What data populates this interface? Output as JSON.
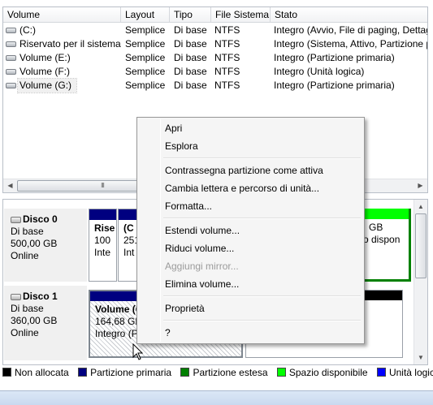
{
  "columns": [
    "Volume",
    "Layout",
    "Tipo",
    "File Sistema",
    "Stato"
  ],
  "volumes": [
    {
      "name": "(C:)",
      "layout": "Semplice",
      "type": "Di base",
      "fs": "NTFS",
      "status": "Integro (Avvio, File di paging, Dettag"
    },
    {
      "name": "Riservato per il sistema",
      "layout": "Semplice",
      "type": "Di base",
      "fs": "NTFS",
      "status": "Integro (Sistema, Attivo, Partizione p"
    },
    {
      "name": "Volume (E:)",
      "layout": "Semplice",
      "type": "Di base",
      "fs": "NTFS",
      "status": "Integro (Partizione primaria)"
    },
    {
      "name": "Volume (F:)",
      "layout": "Semplice",
      "type": "Di base",
      "fs": "NTFS",
      "status": "Integro (Unità logica)"
    },
    {
      "name": "Volume (G:)",
      "layout": "Semplice",
      "type": "Di base",
      "fs": "NTFS",
      "status": "Integro (Partizione primaria)"
    }
  ],
  "hscroll_grip": "III",
  "disks": [
    {
      "title": "Disco 0",
      "type": "Di base",
      "size": "500,00 GB",
      "state": "Online",
      "partitions": [
        {
          "line1": "Rise",
          "line2": "100",
          "line3": "Inte"
        },
        {
          "line1": "(C",
          "line2": "251",
          "line3": "Int"
        },
        {
          "line1": "",
          "line2": "GB",
          "line3": "o dispon"
        }
      ]
    },
    {
      "title": "Disco 1",
      "type": "Di base",
      "size": "360,00 GB",
      "state": "Online",
      "partitions": [
        {
          "line1": "Volume (G:)",
          "line2": "164,68 GB",
          "line3": "Integro (P"
        },
        {
          "line1": "",
          "line2": "",
          "line3": ""
        }
      ]
    }
  ],
  "legend": [
    {
      "label": "Non allocata",
      "color": "#000000"
    },
    {
      "label": "Partizione primaria",
      "color": "#000080"
    },
    {
      "label": "Partizione estesa",
      "color": "#008000"
    },
    {
      "label": "Spazio disponibile",
      "color": "#00ff00"
    },
    {
      "label": "Unità logica",
      "color": "#0000ff"
    }
  ],
  "context_menu": {
    "items": [
      {
        "label": "Apri",
        "enabled": true
      },
      {
        "label": "Esplora",
        "enabled": true
      },
      {
        "separator": true
      },
      {
        "label": "Contrassegna partizione come attiva",
        "enabled": true
      },
      {
        "label": "Cambia lettera e percorso di unità...",
        "enabled": true
      },
      {
        "label": "Formatta...",
        "enabled": true
      },
      {
        "separator": true
      },
      {
        "label": "Estendi volume...",
        "enabled": true
      },
      {
        "label": "Riduci volume...",
        "enabled": true
      },
      {
        "label": "Aggiungi mirror...",
        "enabled": false
      },
      {
        "label": "Elimina volume...",
        "enabled": true
      },
      {
        "separator": true
      },
      {
        "label": "Proprietà",
        "enabled": true
      },
      {
        "separator": true
      },
      {
        "label": "?",
        "enabled": true
      }
    ]
  },
  "icons": [
    "drive-icon",
    "disk-icon",
    "scroll-left-icon",
    "scroll-right-icon",
    "scroll-up-icon",
    "scroll-down-icon",
    "mouse-cursor-icon"
  ]
}
